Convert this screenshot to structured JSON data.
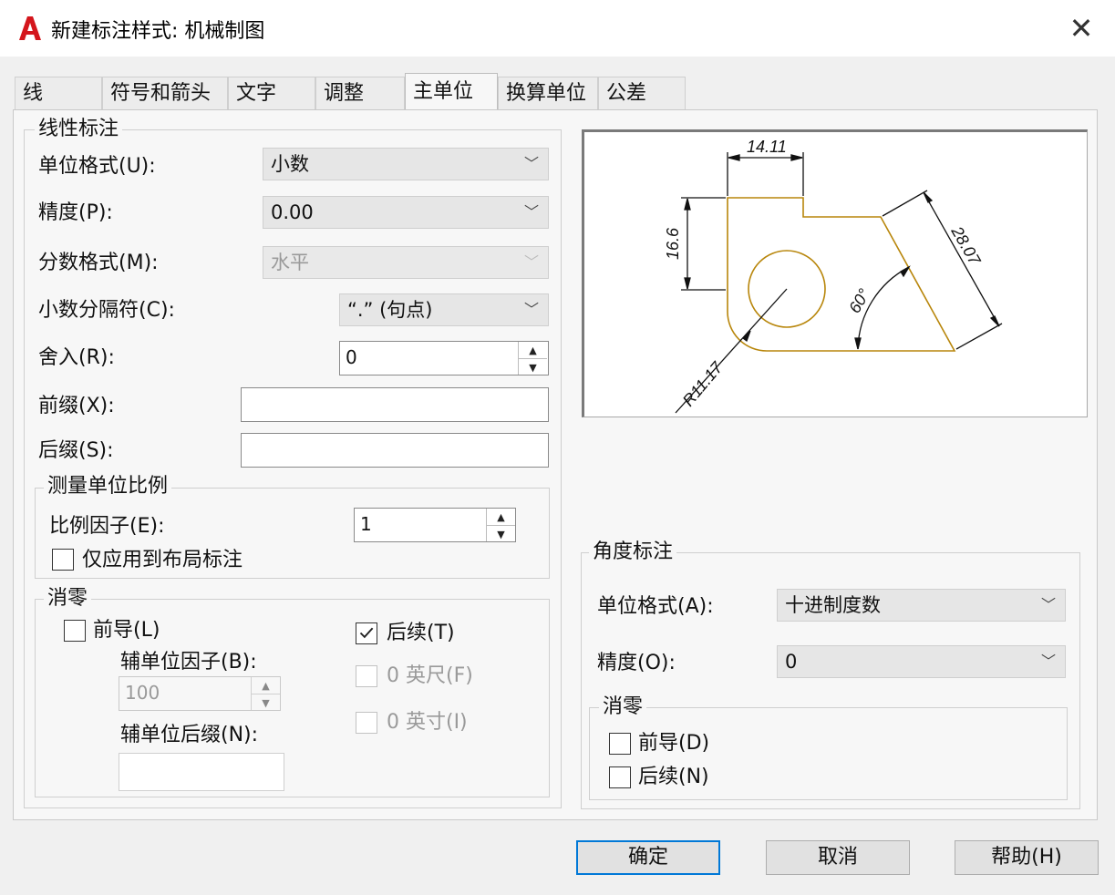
{
  "window": {
    "title": "新建标注样式: 机械制图",
    "close_label": "✕",
    "logo_text": "A"
  },
  "tabs": [
    "线",
    "符号和箭头",
    "文字",
    "调整",
    "主单位",
    "换算单位",
    "公差"
  ],
  "linear": {
    "legend": "线性标注",
    "unit_format_label": "单位格式(U):",
    "unit_format_value": "小数",
    "precision_label": "精度(P):",
    "precision_value": "0.00",
    "fraction_label": "分数格式(M):",
    "fraction_value": "水平",
    "decimal_sep_label": "小数分隔符(C):",
    "decimal_sep_value": "“.” (句点)",
    "round_label": "舍入(R):",
    "round_value": "0",
    "prefix_label": "前缀(X):",
    "prefix_value": "",
    "suffix_label": "后缀(S):",
    "suffix_value": ""
  },
  "scale": {
    "legend": "测量单位比例",
    "factor_label": "比例因子(E):",
    "factor_value": "1",
    "layout_only_label": "仅应用到布局标注",
    "layout_only_checked": false
  },
  "zero_linear": {
    "legend": "消零",
    "leading_label": "前导(L)",
    "leading_checked": false,
    "trailing_label": "后续(T)",
    "trailing_checked": true,
    "sub_factor_label": "辅单位因子(B):",
    "sub_factor_value": "100",
    "sub_suffix_label": "辅单位后缀(N):",
    "sub_suffix_value": "",
    "feet_label": "0 英尺(F)",
    "inches_label": "0 英寸(I)"
  },
  "preview": {
    "dim_top": "14.11",
    "dim_left": "16.6",
    "dim_diag": "28.07",
    "dim_angle": "60°",
    "dim_radius": "R11.17"
  },
  "angular": {
    "legend": "角度标注",
    "unit_format_label": "单位格式(A):",
    "unit_format_value": "十进制度数",
    "precision_label": "精度(O):",
    "precision_value": "0",
    "zero_legend": "消零",
    "leading_label": "前导(D)",
    "trailing_label": "后续(N)"
  },
  "buttons": {
    "ok": "确定",
    "cancel": "取消",
    "help": "帮助(H)"
  },
  "colors": {
    "accent": "#0078d7",
    "logo": "#d4161c",
    "drawing": "#b8860b"
  }
}
